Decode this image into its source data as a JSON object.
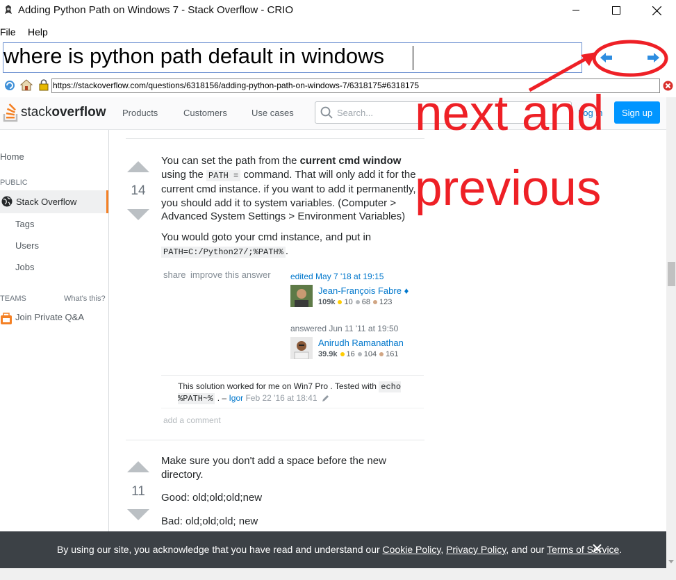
{
  "window": {
    "title": "Adding Python Path on Windows 7 - Stack Overflow - CRIO"
  },
  "menu": {
    "items": [
      "File",
      "Help"
    ]
  },
  "query": {
    "value": "where is python path default in windows"
  },
  "address": {
    "url": "https://stackoverflow.com/questions/6318156/adding-python-path-on-windows-7/6318175#6318175"
  },
  "so_header": {
    "logo_light": "stack",
    "logo_bold": "overflow",
    "nav": [
      "Products",
      "Customers",
      "Use cases"
    ],
    "search_placeholder": "Search...",
    "login": "Log in",
    "signup": "Sign up"
  },
  "sidebar": {
    "home": "Home",
    "public_heading": "PUBLIC",
    "stack_overflow": "Stack Overflow",
    "tags": "Tags",
    "users": "Users",
    "jobs": "Jobs",
    "teams_heading": "TEAMS",
    "whats_this": "What's this?",
    "join": "Join Private Q&A"
  },
  "answer1": {
    "votes": "14",
    "p1_a": "You can set the path from the ",
    "p1_b": "current cmd window",
    "p1_c": " using the ",
    "p1_code": "PATH =",
    "p1_d": " command. That will only add it for the current cmd instance. if you want to add it permanently, you should add it to system variables. (Computer > Advanced System Settings > Environment Variables)",
    "p2": "You would goto your cmd instance, and put in",
    "p2_code": "PATH=C:/Python27/;%PATH%",
    "p2_end": ".",
    "share": "share",
    "improve": "improve this answer",
    "edited_label": "edited May 7 '18 at 19:15",
    "editor": {
      "name": "Jean-François Fabre",
      "diamond": "♦",
      "rep": "109k",
      "gold": "10",
      "silver": "68",
      "bronze": "123"
    },
    "answered_label": "answered Jun 11 '11 at 19:50",
    "author": {
      "name": "Anirudh Ramanathan",
      "rep": "39.9k",
      "gold": "16",
      "silver": "104",
      "bronze": "161"
    },
    "comment_a": "This solution worked for me on Win7 Pro . Tested with ",
    "comment_code": "echo %PATH~%",
    "comment_b": " . – ",
    "comment_user": "Igor",
    "comment_date": " Feb 22 '16 at 18:41",
    "add_comment": "add a comment"
  },
  "answer2": {
    "votes": "11",
    "p1": "Make sure you don't add a space before the new directory.",
    "p2": "Good: old;old;old;new",
    "p3": "Bad: old;old;old; new"
  },
  "annotation": {
    "line1": "next and",
    "line2": "previous"
  },
  "cookie": {
    "t1": "By using our site, you acknowledge that you have read and understand our ",
    "cookie_policy": "Cookie Policy",
    "t2": ", ",
    "privacy_policy": "Privacy Policy",
    "t3": ", and our ",
    "terms": "Terms of Service",
    "t4": "."
  },
  "colors": {
    "annotation": "#ee2026",
    "so_orange": "#f48024",
    "so_blue": "#0095ff"
  }
}
